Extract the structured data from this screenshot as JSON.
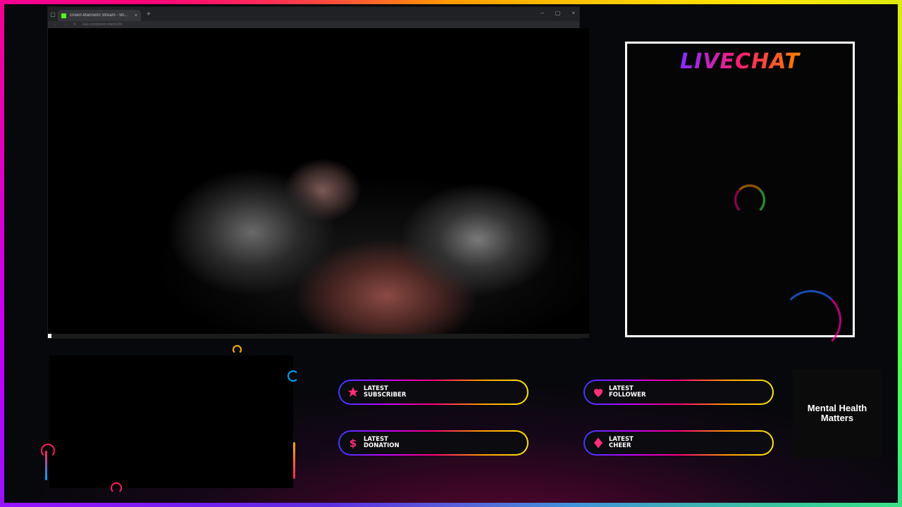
{
  "browser": {
    "tab_title": "Green-Marine00 Stream - Wi...",
    "tab_close": "×",
    "new_tab": "+",
    "window_controls": [
      "–",
      "▢",
      "×"
    ],
    "address_url": "kick.com/green-marine00"
  },
  "player": {
    "progress_fraction": 0.006
  },
  "chat": {
    "title": "LIVECHAT"
  },
  "alerts": [
    {
      "label": "LATEST\nSUBSCRIBER",
      "icon": "star-icon",
      "color": "#ff2d7a"
    },
    {
      "label": "LATEST\nFOLLOWER",
      "icon": "heart-icon",
      "color": "#ff2d7a"
    },
    {
      "label": "LATEST\nDONATION",
      "icon": "dollar-icon",
      "color": "#ff2d7a"
    },
    {
      "label": "LATEST\nCHEER",
      "icon": "diamond-icon",
      "color": "#ff2d7a"
    }
  ],
  "sidebar_box": {
    "text": "Mental Health\nMatters"
  },
  "colors": {
    "accent_pink": "#ff2d7a",
    "frame_gradient": [
      "#ff9a00",
      "#ffe600",
      "#4dff4d",
      "#00c8ff",
      "#3b3bff",
      "#c300ff",
      "#ff007a"
    ]
  }
}
